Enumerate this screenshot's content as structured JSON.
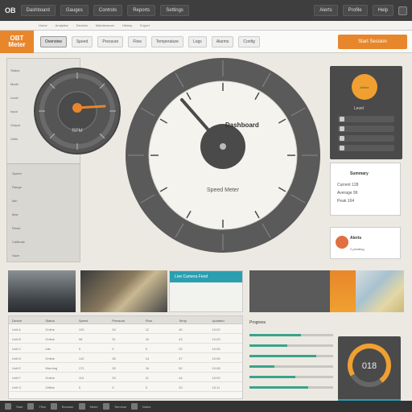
{
  "topbar": {
    "logo": "OB",
    "items": [
      "Dashboard",
      "Gauges",
      "Controls",
      "Reports",
      "Settings"
    ],
    "right": [
      "Alerts",
      "Profile",
      "Help"
    ]
  },
  "subbar": {
    "items": [
      "Home",
      "Analytics",
      "Devices",
      "Maintenance",
      "History",
      "Export"
    ]
  },
  "appbar": {
    "brand_line1": "OBT",
    "brand_line2": "Meter",
    "tabs": [
      "Overview",
      "Speed",
      "Pressure",
      "Flow",
      "Temperature",
      "Logs",
      "Alarms",
      "Config"
    ],
    "active_tab": 0,
    "accent_button": "Start Session",
    "accent_color": "#e8862b"
  },
  "left": {
    "items": [
      "Status",
      "Mode",
      "Level",
      "Input",
      "Output",
      "Units"
    ],
    "lower_items": [
      "Speed",
      "Range",
      "Min",
      "Max",
      "Reset",
      "Calibrate",
      "Save"
    ]
  },
  "mini_gauge": {
    "needle_color": "#e8862b",
    "value_label": "RPM"
  },
  "main_gauge": {
    "label": "Dashboard",
    "sublabel": "Speed Meter",
    "value": 0.82,
    "center_color": "#4a4a4a"
  },
  "right_panel": {
    "badge": "Active",
    "label": "Level",
    "controls": [
      "Mode",
      "Auto",
      "Limit",
      "Power"
    ]
  },
  "card1": {
    "title": "Summary",
    "lines": [
      "Current 128",
      "Average 96",
      "Peak 164"
    ]
  },
  "card2": {
    "title": "Alerts",
    "subtitle": "2 pending"
  },
  "strip": {
    "banner_title": "Live Camera Feed",
    "banner_color": "#2b9fb0"
  },
  "table": {
    "headers": [
      "Device",
      "Status",
      "Speed",
      "Pressure",
      "Flow",
      "Temp",
      "Updated"
    ],
    "rows": [
      [
        "Unit A",
        "Online",
        "120",
        "34",
        "12",
        "45",
        "10:02"
      ],
      [
        "Unit B",
        "Online",
        "98",
        "31",
        "10",
        "43",
        "10:03"
      ],
      [
        "Unit C",
        "Idle",
        "0",
        "0",
        "0",
        "22",
        "10:05"
      ],
      [
        "Unit D",
        "Online",
        "142",
        "36",
        "14",
        "47",
        "10:06"
      ],
      [
        "Unit E",
        "Warning",
        "171",
        "39",
        "16",
        "52",
        "10:08"
      ],
      [
        "Unit F",
        "Online",
        "110",
        "33",
        "11",
        "44",
        "10:09"
      ],
      [
        "Unit G",
        "Offline",
        "0",
        "0",
        "0",
        "20",
        "10:11"
      ]
    ]
  },
  "progress_panel": {
    "title": "Progress",
    "items": [
      0.62,
      0.45,
      0.8,
      0.3,
      0.55,
      0.7
    ]
  },
  "dark_gauge": {
    "value_text": "018",
    "ring_color": "#f0a030"
  },
  "taskbar": {
    "items": [
      "Start",
      "Files",
      "Browser",
      "Meter",
      "Terminal",
      "Notes"
    ]
  }
}
